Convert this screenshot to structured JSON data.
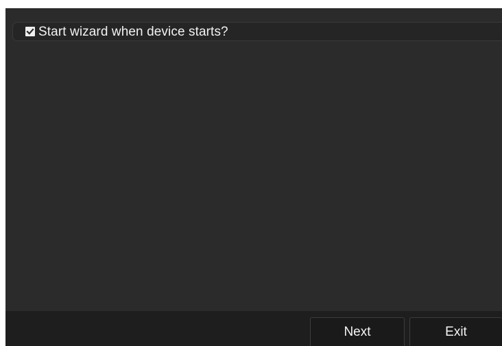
{
  "wizard": {
    "start_on_boot": {
      "checked": true,
      "label": "Start wizard when device starts?"
    }
  },
  "footer": {
    "next_label": "Next",
    "exit_label": "Exit"
  },
  "icons": {
    "checkbox": "check-icon"
  },
  "colors": {
    "panel_background": "#2b2b2b",
    "footer_background": "#1e1e1e",
    "text": "#f2f2f2"
  }
}
